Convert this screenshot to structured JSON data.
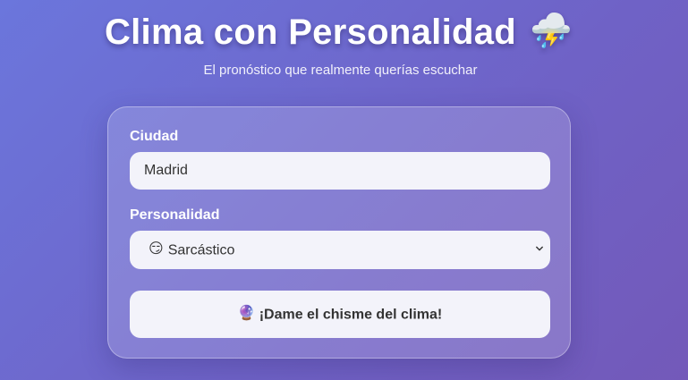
{
  "header": {
    "title": "Clima con Personalidad",
    "title_icon": "⛈️",
    "subtitle": "El pronóstico que realmente querías escuchar"
  },
  "form": {
    "city_label": "Ciudad",
    "city_value": "Madrid",
    "personality_label": "Personalidad",
    "personality_icon": "😏",
    "personality_value": "Sarcástico",
    "submit_icon": "🔮",
    "submit_label": "¡Dame el chisme del clima!"
  },
  "colors": {
    "background_start": "#6b76dc",
    "background_end": "#7359b9",
    "field_background": "#f3f3fa",
    "text_dark": "#333333"
  }
}
